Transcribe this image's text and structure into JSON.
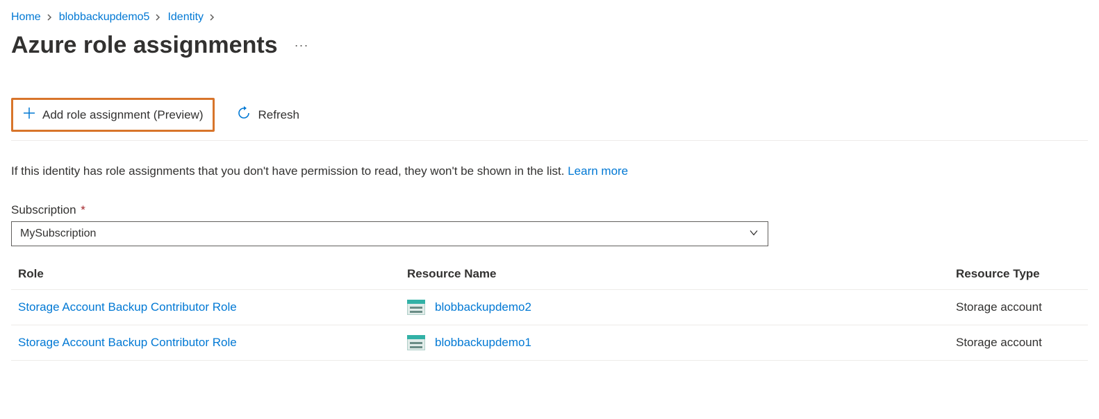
{
  "breadcrumb": {
    "items": [
      "Home",
      "blobbackupdemo5",
      "Identity"
    ]
  },
  "page_title": "Azure role assignments",
  "toolbar": {
    "add_role_label": "Add role assignment (Preview)",
    "refresh_label": "Refresh"
  },
  "info": {
    "text": "If this identity has role assignments that you don't have permission to read, they won't be shown in the list. ",
    "learn_more": "Learn more"
  },
  "subscription": {
    "label": "Subscription",
    "required_marker": "*",
    "value": "MySubscription"
  },
  "table": {
    "headers": {
      "role": "Role",
      "resource_name": "Resource Name",
      "resource_type": "Resource Type"
    },
    "rows": [
      {
        "role": "Storage Account Backup Contributor Role",
        "resource_name": "blobbackupdemo2",
        "resource_type": "Storage account"
      },
      {
        "role": "Storage Account Backup Contributor Role",
        "resource_name": "blobbackupdemo1",
        "resource_type": "Storage account"
      }
    ]
  }
}
